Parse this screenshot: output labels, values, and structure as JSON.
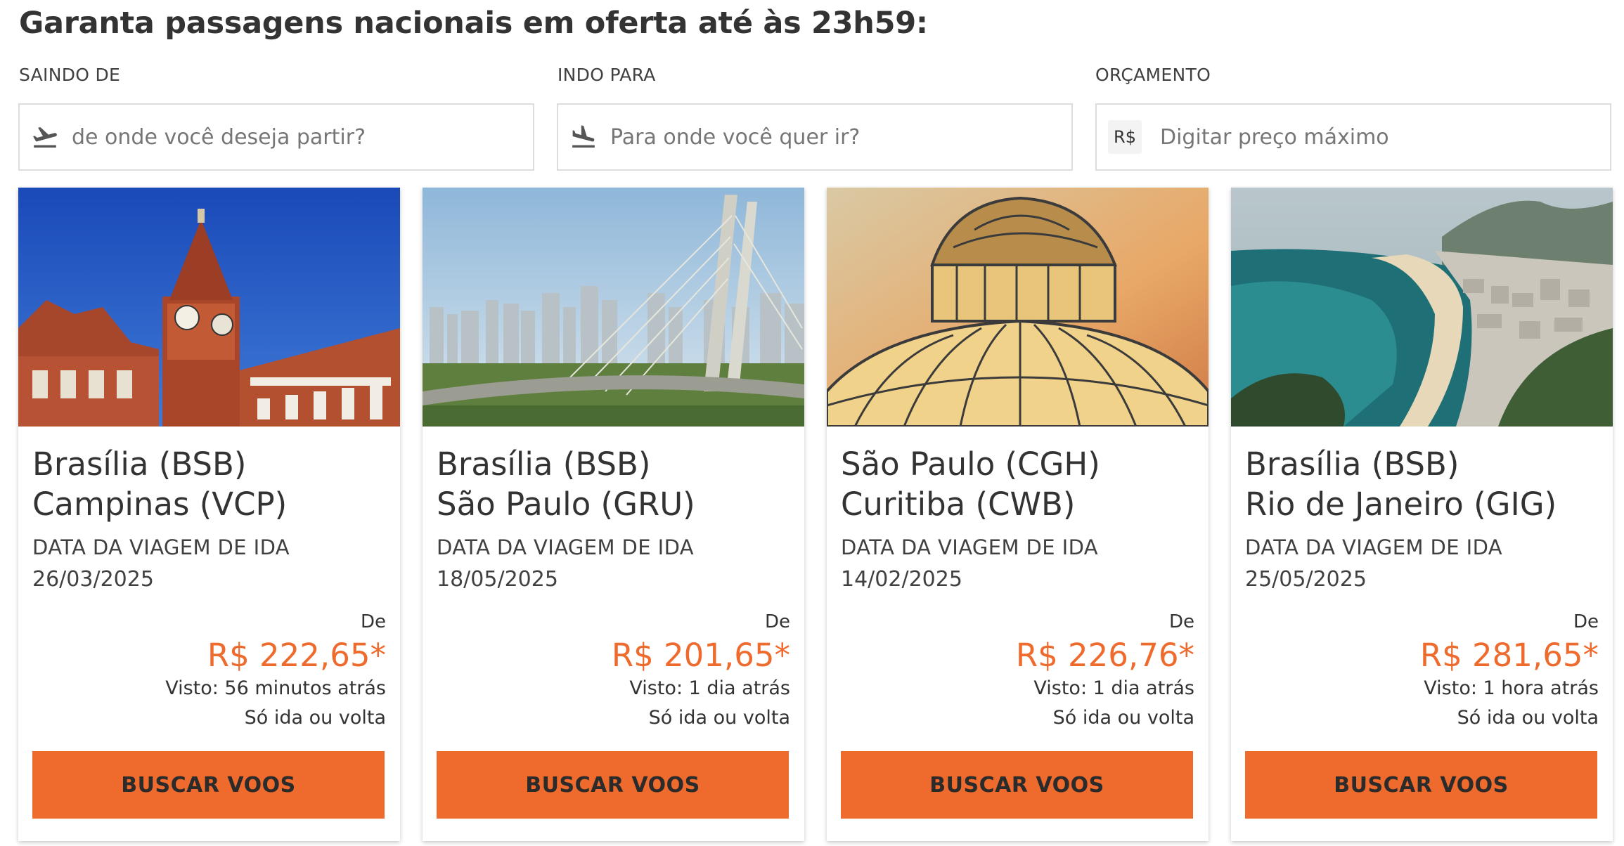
{
  "headline": "Garanta passagens nacionais em oferta até às 23h59:",
  "filters": {
    "from": {
      "label": "SAINDO DE",
      "placeholder": "de onde você deseja partir?",
      "icon": "airplane-takeoff-icon"
    },
    "to": {
      "label": "INDO PARA",
      "placeholder": "Para onde você quer ir?",
      "icon": "airplane-landing-icon"
    },
    "budget": {
      "label": "ORÇAMENTO",
      "currency": "R$",
      "placeholder": "Digitar preço máximo"
    }
  },
  "colors": {
    "accent": "#ee6b2d",
    "text": "#333333",
    "border": "#dddddd"
  },
  "cards": [
    {
      "origin": "Brasília (BSB)",
      "destination": "Campinas (VCP)",
      "date_label": "DATA DA VIAGEM DE IDA",
      "date": "26/03/2025",
      "from_label": "De",
      "price": "R$ 222,65*",
      "seen": "Visto: 56 minutos atrás",
      "trip_type": "Só ida ou volta",
      "button": "BUSCAR VOOS",
      "image": "campinas-clock-tower-photo"
    },
    {
      "origin": "Brasília (BSB)",
      "destination": "São Paulo (GRU)",
      "date_label": "DATA DA VIAGEM DE IDA",
      "date": "18/05/2025",
      "from_label": "De",
      "price": "R$ 201,65*",
      "seen": "Visto: 1 dia atrás",
      "trip_type": "Só ida ou volta",
      "button": "BUSCAR VOOS",
      "image": "sao-paulo-bridge-photo"
    },
    {
      "origin": "São Paulo (CGH)",
      "destination": "Curitiba (CWB)",
      "date_label": "DATA DA VIAGEM DE IDA",
      "date": "14/02/2025",
      "from_label": "De",
      "price": "R$ 226,76*",
      "seen": "Visto: 1 dia atrás",
      "trip_type": "Só ida ou volta",
      "button": "BUSCAR VOOS",
      "image": "curitiba-greenhouse-photo"
    },
    {
      "origin": "Brasília (BSB)",
      "destination": "Rio de Janeiro (GIG)",
      "date_label": "DATA DA VIAGEM DE IDA",
      "date": "25/05/2025",
      "from_label": "De",
      "price": "R$ 281,65*",
      "seen": "Visto: 1 hora atrás",
      "trip_type": "Só ida ou volta",
      "button": "BUSCAR VOOS",
      "image": "rio-copacabana-photo"
    }
  ]
}
